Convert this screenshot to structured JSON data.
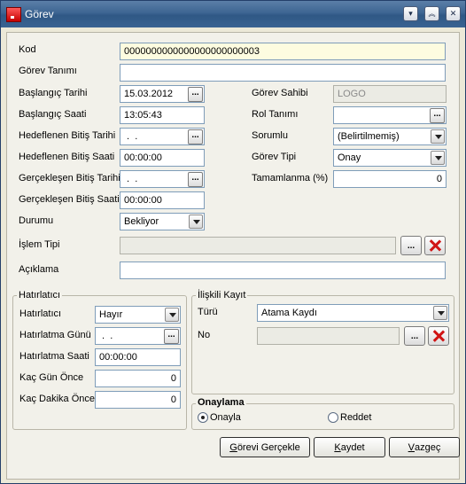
{
  "window": {
    "title": "Görev"
  },
  "form": {
    "kod": {
      "label": "Kod",
      "value": "0000000000000000000000003"
    },
    "gorev_tanimi": {
      "label": "Görev Tanımı",
      "value": ""
    },
    "baslangic_tarihi": {
      "label": "Başlangıç Tarihi",
      "value": "15.03.2012"
    },
    "baslangic_saati": {
      "label": "Başlangıç Saati",
      "value": "13:05:43"
    },
    "hedef_bitis_tarihi": {
      "label": "Hedeflenen Bitiş Tarihi",
      "value": " .  ."
    },
    "hedef_bitis_saati": {
      "label": "Hedeflenen Bitiş Saati",
      "value": "00:00:00"
    },
    "gercek_bitis_tarihi": {
      "label": "Gerçekleşen Bitiş Tarihi",
      "value": " .  ."
    },
    "gercek_bitis_saati": {
      "label": "Gerçekleşen Bitiş Saati",
      "value": "00:00:00"
    },
    "durumu": {
      "label": "Durumu",
      "value": "Bekliyor"
    },
    "islem_tipi": {
      "label": "İşlem Tipi",
      "value": ""
    },
    "aciklama": {
      "label": "Açıklama",
      "value": ""
    },
    "gorev_sahibi": {
      "label": "Görev Sahibi",
      "value": "LOGO"
    },
    "rol_tanimi": {
      "label": "Rol Tanımı",
      "value": ""
    },
    "sorumlu": {
      "label": "Sorumlu",
      "value": "(Belirtilmemiş)"
    },
    "gorev_tipi": {
      "label": "Görev Tipi",
      "value": "Onay"
    },
    "tamamlanma": {
      "label": "Tamamlanma (%)",
      "value": "0"
    }
  },
  "hatirlatici": {
    "title": "Hatırlatıcı",
    "hatirlatici": {
      "label": "Hatırlatıcı",
      "value": "Hayır"
    },
    "hatirlatma_gunu": {
      "label": "Hatırlatma Günü",
      "value": " .  ."
    },
    "hatirlatma_saati": {
      "label": "Hatırlatma Saati",
      "value": "00:00:00"
    },
    "kac_gun_once": {
      "label": "Kaç Gün Önce",
      "value": "0"
    },
    "kac_dakika_once": {
      "label": "Kaç Dakika Önce",
      "value": "0"
    }
  },
  "iliskili_kayit": {
    "title": "İlişkili Kayıt",
    "turu": {
      "label": "Türü",
      "value": "Atama Kaydı"
    },
    "no": {
      "label": "No",
      "value": ""
    }
  },
  "onaylama": {
    "title": "Onaylama",
    "options": [
      {
        "label": "Onayla",
        "checked": true
      },
      {
        "label": "Reddet",
        "checked": false
      }
    ]
  },
  "buttons": {
    "gorevi_gerceklestir": {
      "underline": "G",
      "rest": "örevi Gerçekle"
    },
    "kaydet": {
      "underline": "K",
      "rest": "aydet"
    },
    "vazgec": {
      "underline": "V",
      "rest": "azgeç"
    }
  },
  "icons": {
    "title_minimize": "chevron-down-icon",
    "title_maximize": "chevron-up-double-icon",
    "title_close": "close-icon",
    "lookup": "ellipsis-icon",
    "clear": "red-x-icon"
  },
  "colors": {
    "titlebar": "#3d6592",
    "key_field": "#fdfce0",
    "clear_icon": "#d01414"
  }
}
